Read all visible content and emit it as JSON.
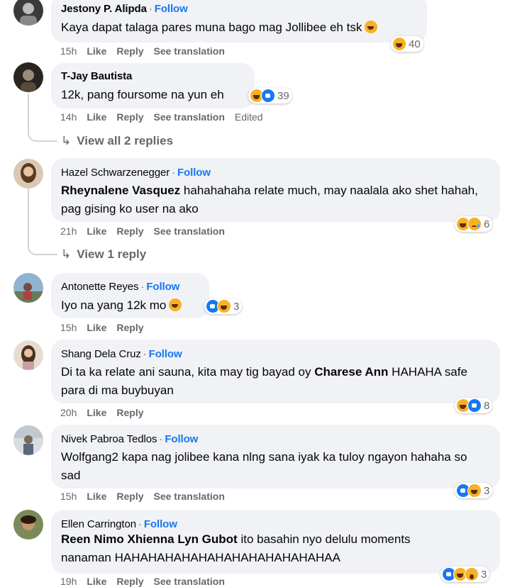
{
  "comments": [
    {
      "name": "Jestony P. Alipda",
      "follow": "Follow",
      "text": "Kaya dapat talaga pares muna bago mag Jollibee eh tsk",
      "time": "15h",
      "like": "Like",
      "reply": "Reply",
      "translate": "See translation",
      "reactions": [
        "haha"
      ],
      "count": "40"
    },
    {
      "name": "T-Jay Bautista",
      "follow": "",
      "text": "12k, pang foursome na yun eh",
      "time": "14h",
      "like": "Like",
      "reply": "Reply",
      "translate": "See translation",
      "edited": "Edited",
      "reactions": [
        "haha",
        "like"
      ],
      "count": "39"
    },
    {
      "name": "Hazel Schwarzenegger",
      "follow": "Follow",
      "mention": "Rheynalene Vasquez",
      "text": "hahahahaha relate much, may naalala ako shet hahah, pag gising ko user na ako",
      "time": "21h",
      "like": "Like",
      "reply": "Reply",
      "translate": "See translation",
      "reactions": [
        "haha",
        "sad"
      ],
      "count": "6"
    },
    {
      "name": "Antonette Reyes",
      "follow": "Follow",
      "text": "Iyo na yang 12k mo",
      "time": "15h",
      "like": "Like",
      "reply": "Reply",
      "reactions": [
        "like",
        "haha"
      ],
      "count": "3"
    },
    {
      "name": "Shang Dela Cruz",
      "follow": "Follow",
      "text_a": "Di ta ka relate ani sauna, kita may tig bayad oy",
      "mention": "Charese Ann",
      "text_b": "HAHAHA safe para di ma buybuyan",
      "time": "20h",
      "like": "Like",
      "reply": "Reply",
      "reactions": [
        "haha",
        "like"
      ],
      "count": "8"
    },
    {
      "name": "Nivek Pabroa Tedlos",
      "follow": "Follow",
      "text": "Wolfgang2 kapa nag jolibee kana nlng sana iyak ka tuloy ngayon hahaha so sad",
      "time": "15h",
      "like": "Like",
      "reply": "Reply",
      "translate": "See translation",
      "reactions": [
        "like",
        "haha"
      ],
      "count": "3"
    },
    {
      "name": "Ellen Carrington",
      "follow": "Follow",
      "mention": "Reen Nimo Xhienna Lyn Gubot",
      "text": "ito basahin nyo delulu moments nanaman HAHAHAHAHAHAHAHAHAHAHAHAHAA",
      "time": "19h",
      "like": "Like",
      "reply": "Reply",
      "translate": "See translation",
      "reactions": [
        "like",
        "haha",
        "wow"
      ],
      "count": "3"
    }
  ],
  "view_replies": {
    "c2": "View all 2 replies",
    "c3": "View 1 reply"
  },
  "dot": "·"
}
